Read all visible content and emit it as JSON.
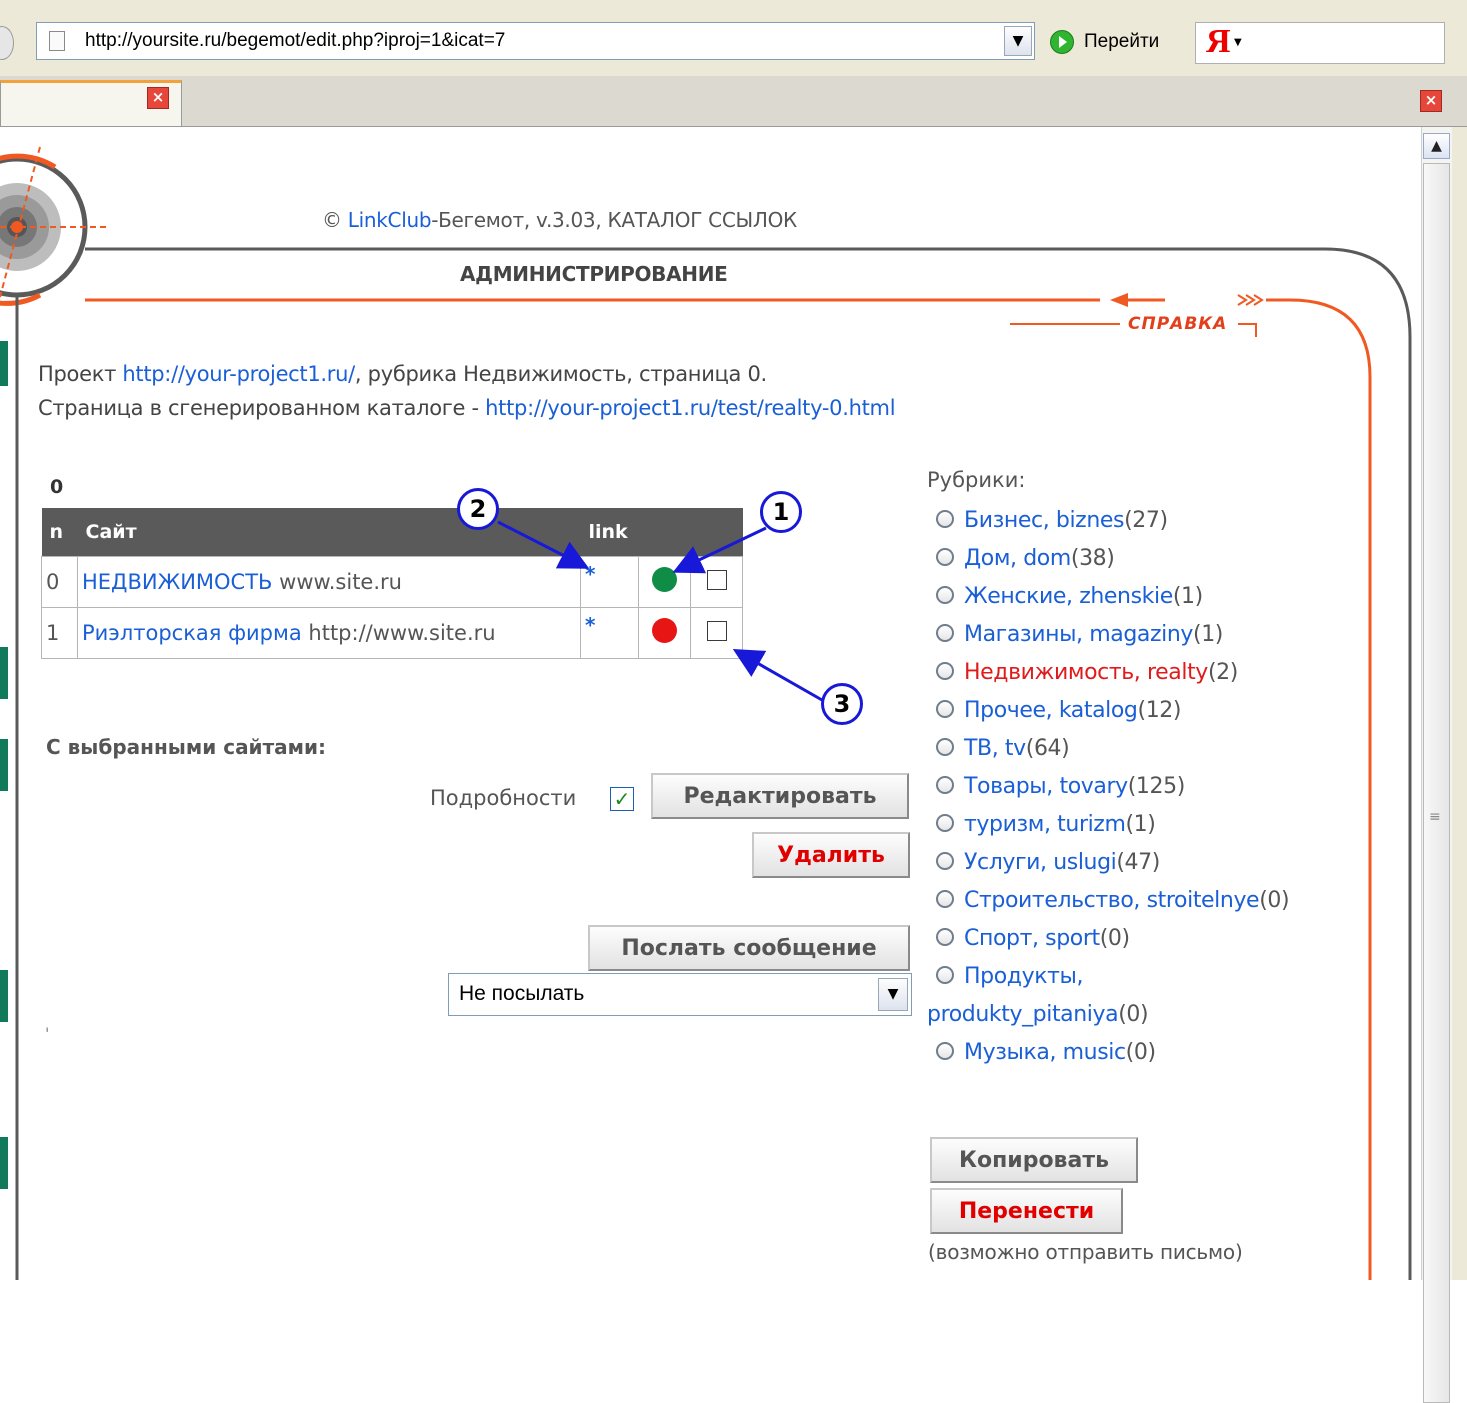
{
  "browser": {
    "address_url": "http://yoursite.ru/begemot/edit.php?iproj=1&icat=7",
    "go_label": "Перейти",
    "yandex_logo": "Я"
  },
  "header": {
    "copyright_symbol": "©",
    "brand_link": "LinkClub",
    "credit_rest": "-Бегемот, v.3.03, КАТАЛОГ ССЫЛОК",
    "section_title": "АДМИНИСТРИРОВАНИЕ",
    "help_label": "СПРАВКА"
  },
  "info": {
    "project_prefix": "Проект ",
    "project_url": "http://your-project1.ru/",
    "project_suffix": ", рубрика Недвижимость, страница 0.",
    "generated_prefix": "Страница в сгенерированном каталоге - ",
    "generated_url": "http://your-project1.ru/test/realty-0.html"
  },
  "table": {
    "page_number": "0",
    "headers": {
      "n": "n",
      "site": "Сайт",
      "link": "link"
    },
    "rows": [
      {
        "n": "0",
        "title": "НЕДВИЖИМОСТЬ",
        "url": " www.site.ru",
        "link": "*",
        "status_color": "#0f8c46"
      },
      {
        "n": "1",
        "title": "Риэлторская фирма",
        "url": " http://www.site.ru",
        "link": "*",
        "status_color": "#e81515"
      }
    ]
  },
  "callouts": {
    "one": "1",
    "two": "2",
    "three": "3"
  },
  "actions": {
    "with_selected": "С выбранными сайтами:",
    "details_label": "Подробности",
    "details_checked": true,
    "edit_label": "Редактировать",
    "delete_label": "Удалить",
    "send_message_label": "Послать сообщение",
    "message_select_value": "Не посылать",
    "stray_mark": "'"
  },
  "categories": {
    "title": "Рубрики:",
    "items": [
      {
        "name": "Бизнес, biznes",
        "count": "(27)"
      },
      {
        "name": "Дом, dom",
        "count": "(38)"
      },
      {
        "name": "Женские, zhenskie",
        "count": "(1)"
      },
      {
        "name": "Магазины, magaziny",
        "count": "(1)"
      },
      {
        "name": "Недвижимость, realty",
        "count": "(2)"
      },
      {
        "name": "Прочее, katalog",
        "count": "(12)"
      },
      {
        "name": "ТВ, tv",
        "count": "(64)"
      },
      {
        "name": "Товары, tovary",
        "count": "(125)"
      },
      {
        "name": "туризм, turizm",
        "count": "(1)"
      },
      {
        "name": "Услуги, uslugi",
        "count": "(47)"
      },
      {
        "name": "Строительство, stroitelnye",
        "count": "(0)"
      },
      {
        "name": "Спорт, sport",
        "count": "(0)"
      },
      {
        "name": "Продукты, produkty_pitaniya",
        "count": "(0)"
      },
      {
        "name": "Музыка, music",
        "count": "(0)"
      }
    ],
    "copy_label": "Копировать",
    "move_label": "Перенести",
    "note": "(возможно отправить письмо)"
  },
  "colors": {
    "accent_orange": "#f05a22",
    "link_blue": "#1a5fd6",
    "callout_blue": "#1818d8"
  }
}
